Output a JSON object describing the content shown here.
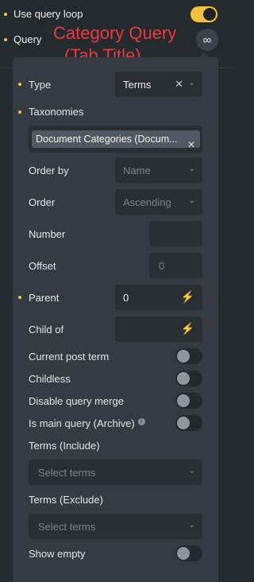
{
  "top": {
    "use_query_loop_label": "Use query loop",
    "query_label": "Query",
    "loop_icon": "infinity-icon",
    "annotation_line1": "Category Query",
    "annotation_line2": "(Tab Title)"
  },
  "panel": {
    "type": {
      "label": "Type",
      "value": "Terms"
    },
    "taxonomies": {
      "label": "Taxonomies",
      "tag": "Document Categories (Docum..."
    },
    "order_by": {
      "label": "Order by",
      "placeholder": "Name"
    },
    "order": {
      "label": "Order",
      "placeholder": "Ascending"
    },
    "number": {
      "label": "Number",
      "value": ""
    },
    "offset": {
      "label": "Offset",
      "placeholder": "0"
    },
    "parent": {
      "label": "Parent",
      "value": "0"
    },
    "child_of": {
      "label": "Child of",
      "value": ""
    },
    "current_post_term": {
      "label": "Current post term"
    },
    "childless": {
      "label": "Childless"
    },
    "disable_query_merge": {
      "label": "Disable query merge"
    },
    "is_main_query": {
      "label": "Is main query (Archive)"
    },
    "terms_include": {
      "label": "Terms (Include)",
      "placeholder": "Select terms"
    },
    "terms_exclude": {
      "label": "Terms (Exclude)",
      "placeholder": "Select terms"
    },
    "show_empty": {
      "label": "Show empty"
    }
  },
  "colors": {
    "accent": "#f2c23a",
    "annotation": "#ea3a3a",
    "panel": "#353b41"
  }
}
